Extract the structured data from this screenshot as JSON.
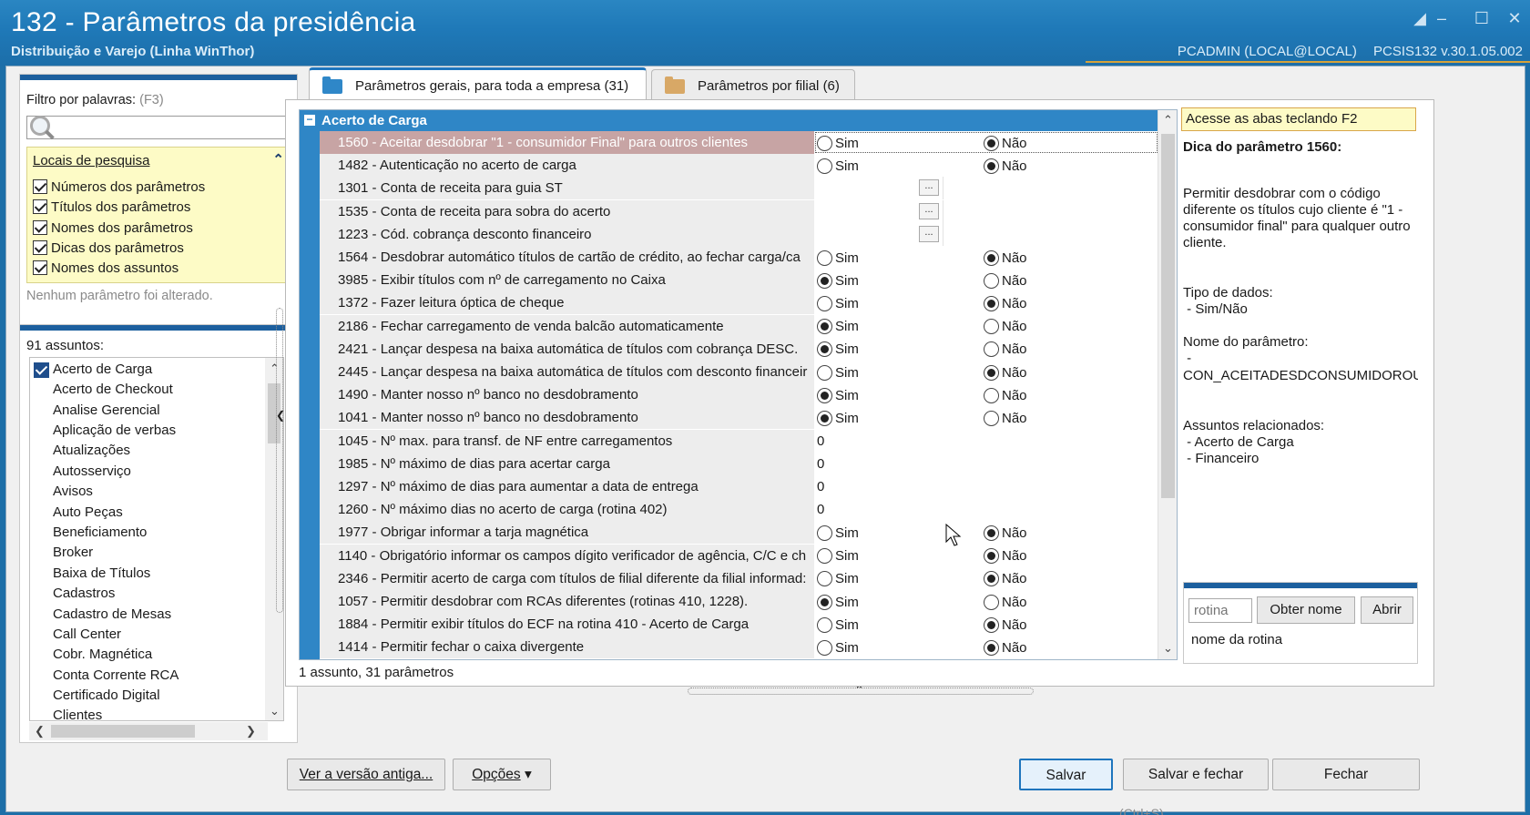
{
  "window": {
    "title": "132 - Parâmetros da presidência",
    "subtitle": "Distribuição e Varejo (Linha WinThor)",
    "user": "PCADMIN (LOCAL@LOCAL)",
    "version": "PCSIS132  v.30.1.05.002"
  },
  "filter": {
    "label": "Filtro por palavras:",
    "shortcut": "(F3)",
    "search_value": "",
    "locais_title": "Locais de pesquisa",
    "options": [
      {
        "label": "Números dos parâmetros",
        "checked": true
      },
      {
        "label": "Títulos dos parâmetros",
        "checked": true
      },
      {
        "label": "Nomes dos parâmetros",
        "checked": true
      },
      {
        "label": "Dicas dos parâmetros",
        "checked": true
      },
      {
        "label": "Nomes dos assuntos",
        "checked": true
      }
    ],
    "status": "Nenhum parâmetro foi alterado."
  },
  "assuntos": {
    "count_label": "91 assuntos:",
    "items": [
      {
        "label": "Acerto de Carga",
        "checked": true
      },
      {
        "label": "Acerto de Checkout"
      },
      {
        "label": "Analise Gerencial"
      },
      {
        "label": "Aplicação de verbas"
      },
      {
        "label": "Atualizações"
      },
      {
        "label": "Autosserviço"
      },
      {
        "label": "Avisos"
      },
      {
        "label": "Auto Peças"
      },
      {
        "label": "Beneficiamento"
      },
      {
        "label": "Broker"
      },
      {
        "label": "Baixa de Títulos"
      },
      {
        "label": "Cadastros"
      },
      {
        "label": "Cadastro de Mesas"
      },
      {
        "label": "Call Center"
      },
      {
        "label": "Cobr. Magnética"
      },
      {
        "label": "Conta Corrente RCA"
      },
      {
        "label": "Certificado Digital"
      },
      {
        "label": "Clientes"
      }
    ]
  },
  "tabs": [
    {
      "label": "Parâmetros gerais, para toda a empresa",
      "count": "(31)",
      "active": true
    },
    {
      "label": "Parâmetros por filial",
      "count": "(6)",
      "active": false
    }
  ],
  "grid": {
    "group": "Acerto de Carga",
    "sim": "Sim",
    "nao": "Não",
    "rows": [
      {
        "name": "1560 - Aceitar desdobrar \"1 - consumidor Final\" para outros clientes",
        "type": "bool",
        "value": "nao",
        "selected": true
      },
      {
        "name": "1482 - Autenticação no acerto de carga",
        "type": "bool",
        "value": "nao"
      },
      {
        "name": "1301 - Conta de receita para guia ST",
        "type": "lookup",
        "value": "..."
      },
      {
        "name": "1535 - Conta de receita para sobra do acerto",
        "type": "lookup",
        "value": "..."
      },
      {
        "name": "1223 - Cód. cobrança desconto financeiro",
        "type": "lookup",
        "value": "..."
      },
      {
        "name": "1564 - Desdobrar automático títulos de cartão de crédito, ao fechar carga/ca",
        "type": "bool",
        "value": "nao"
      },
      {
        "name": "3985 - Exibir títulos com nº de carregamento no Caixa",
        "type": "bool",
        "value": "sim"
      },
      {
        "name": "1372 - Fazer leitura óptica de cheque",
        "type": "bool",
        "value": "nao"
      },
      {
        "name": "2186 - Fechar carregamento de venda balcão automaticamente",
        "type": "bool",
        "value": "sim"
      },
      {
        "name": "2421 - Lançar despesa na baixa automática de títulos com cobrança DESC.",
        "type": "bool",
        "value": "sim"
      },
      {
        "name": "2445 - Lançar despesa na baixa automática de títulos com desconto financeir",
        "type": "bool",
        "value": "nao"
      },
      {
        "name": "1490 - Manter nosso nº banco no desdobramento",
        "type": "bool",
        "value": "sim"
      },
      {
        "name": "1041 - Manter nosso nº banco no desdobramento",
        "type": "bool",
        "value": "sim"
      },
      {
        "name": "1045 - Nº max. para transf. de NF entre carregamentos",
        "type": "number",
        "value": "0"
      },
      {
        "name": "1985 - Nº máximo de dias para acertar carga",
        "type": "number",
        "value": "0"
      },
      {
        "name": "1297 - Nº máximo de dias para aumentar a data de entrega",
        "type": "number",
        "value": "0"
      },
      {
        "name": "1260 - Nº máximo dias no acerto de carga (rotina 402)",
        "type": "number",
        "value": "0"
      },
      {
        "name": "1977 - Obrigar informar a tarja magnética",
        "type": "bool",
        "value": "nao"
      },
      {
        "name": "1140 - Obrigatório informar os campos dígito verificador de agência, C/C e ch",
        "type": "bool",
        "value": "nao"
      },
      {
        "name": "2346 - Permitir acerto de carga com títulos de filial diferente da filial informad:",
        "type": "bool",
        "value": "nao"
      },
      {
        "name": "1057 - Permitir desdobrar com RCAs diferentes (rotinas 410, 1228).",
        "type": "bool",
        "value": "sim"
      },
      {
        "name": "1884 - Permitir exibir títulos do ECF na rotina 410 - Acerto de Carga",
        "type": "bool",
        "value": "nao"
      },
      {
        "name": "1414 - Permitir fechar o caixa divergente",
        "type": "bool",
        "value": "nao"
      }
    ],
    "status": "1 assunto, 31 parâmetros"
  },
  "tips": {
    "hint": "Acesse as abas teclando F2",
    "title": "Dica do parâmetro 1560:",
    "description_1": "Permitir desdobrar com o código",
    "description_2": "diferente os títulos cujo cliente é \"1 -",
    "description_3": "consumidor final\" para qualquer outro",
    "description_4": "cliente.",
    "type_label": "Tipo de dados:",
    "type_value": " - Sim/Não",
    "name_label": "Nome do parâmetro:",
    "name_dash": " -",
    "name_value": "CON_ACEITADESDCONSUMIDOROUT",
    "related_label": "Assuntos relacionados:",
    "related_1": " - Acerto de Carga",
    "related_2": " - Financeiro"
  },
  "rotina": {
    "placeholder": "rotina",
    "get_name": "Obter nome",
    "open": "Abrir",
    "name_label": "nome da rotina"
  },
  "footer": {
    "old_version": "Ver a versão antiga...",
    "options": "Opções",
    "save": "Salvar",
    "save_shortcut": "(Ctrl+S)",
    "save_close": "Salvar e fechar",
    "close": "Fechar"
  }
}
